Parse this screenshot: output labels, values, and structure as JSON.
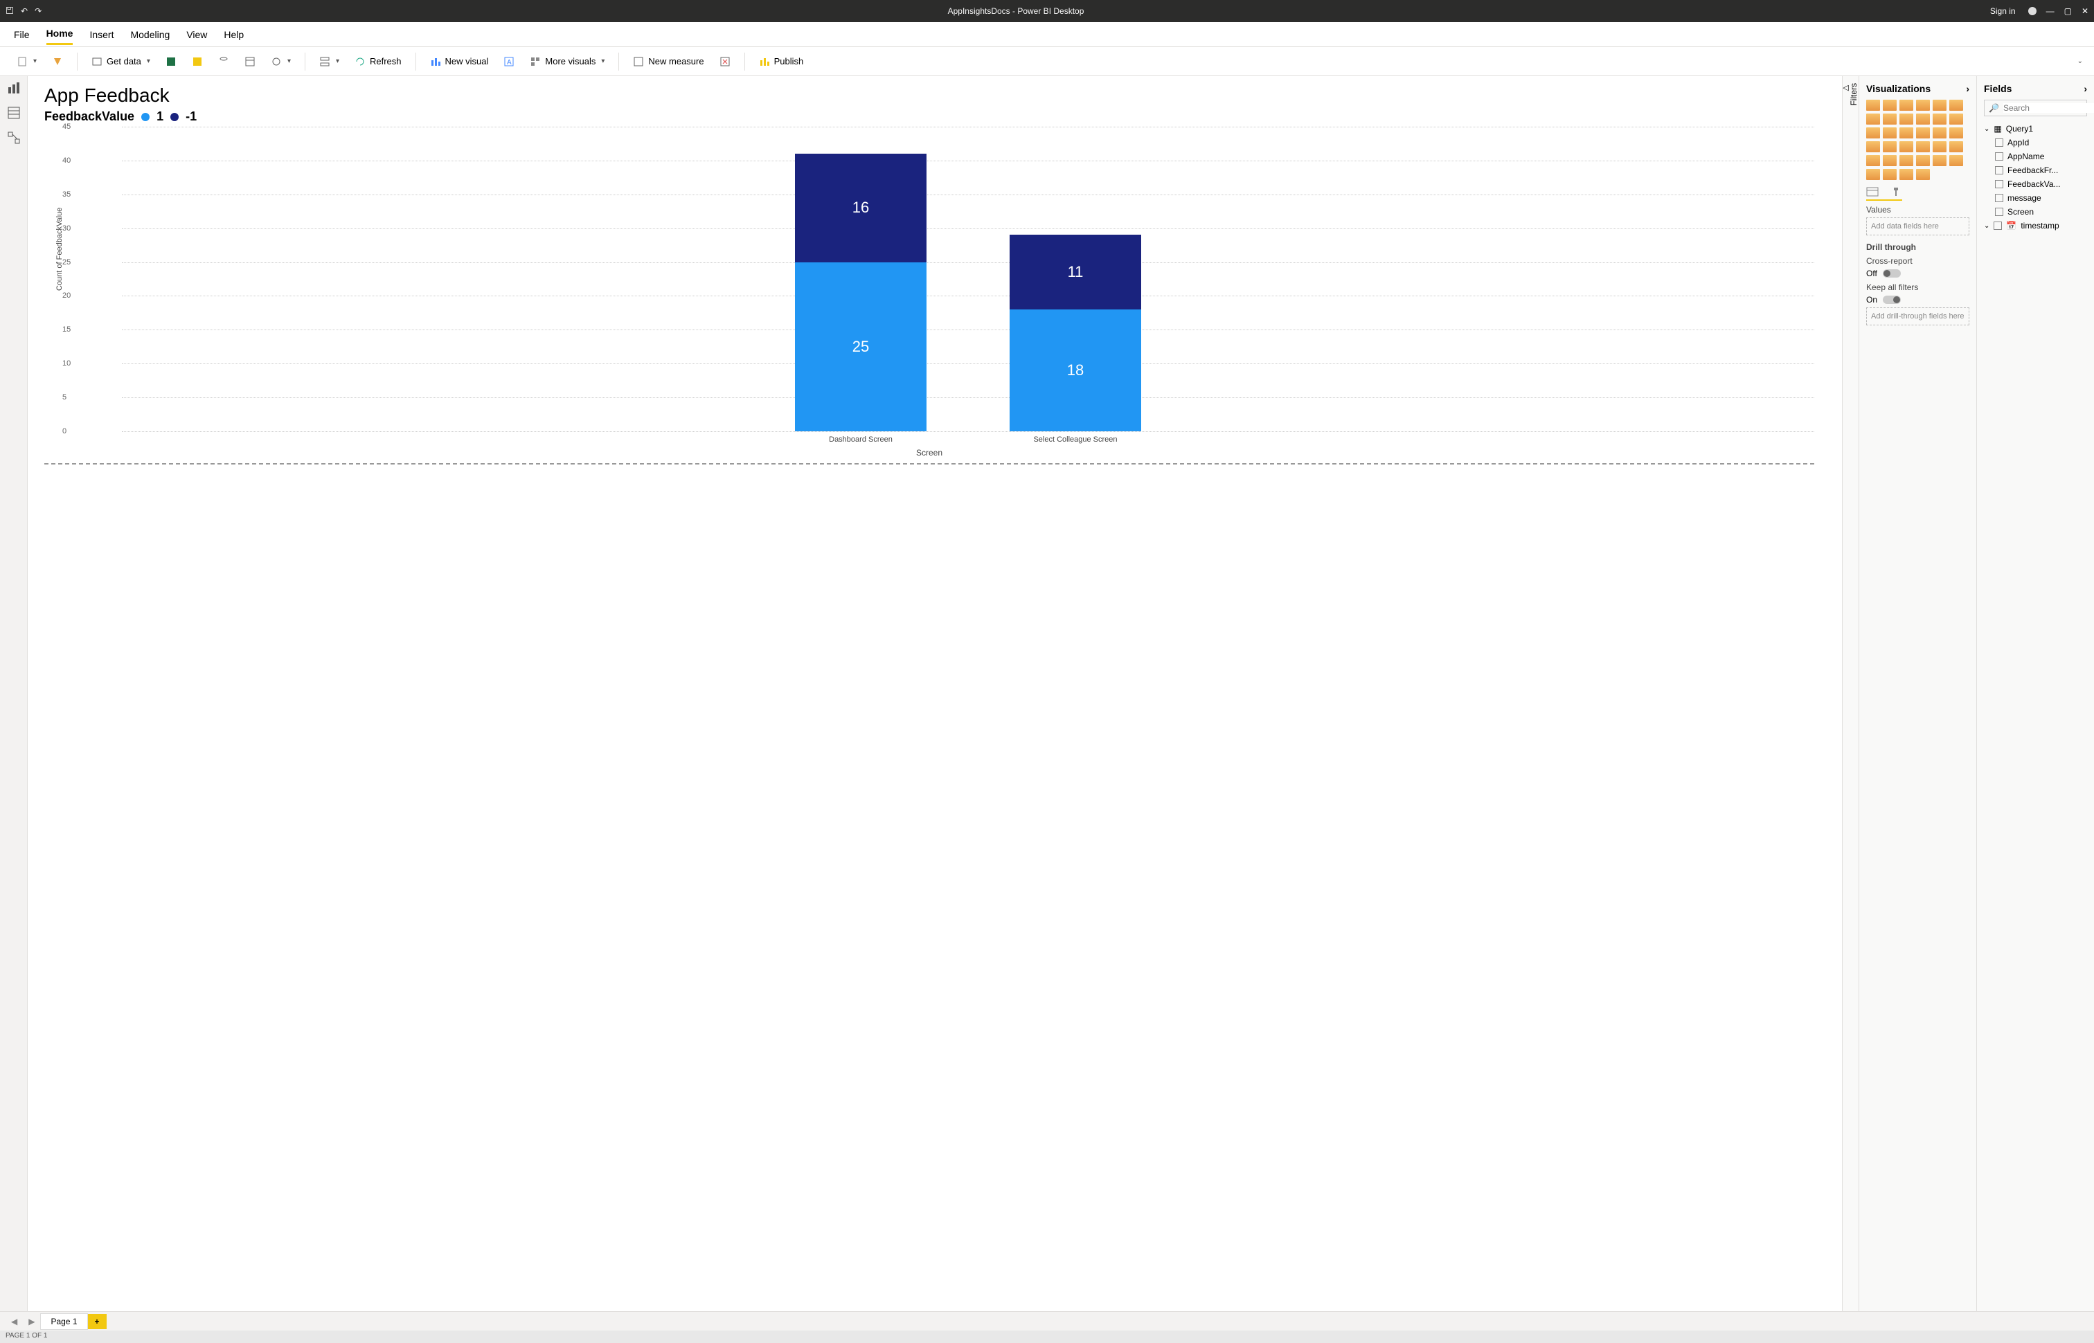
{
  "titlebar": {
    "doc_title": "AppInsightsDocs - Power BI Desktop",
    "signin": "Sign in"
  },
  "menus": [
    "File",
    "Home",
    "Insert",
    "Modeling",
    "View",
    "Help"
  ],
  "active_menu": "Home",
  "ribbon": {
    "getdata": "Get data",
    "refresh": "Refresh",
    "newvisual": "New visual",
    "morevisuals": "More visuals",
    "newmeasure": "New measure",
    "publish": "Publish"
  },
  "report": {
    "title": "App Feedback",
    "legend_title": "FeedbackValue",
    "legend": [
      {
        "label": "1",
        "color": "#2196f3"
      },
      {
        "label": "-1",
        "color": "#1a237e"
      }
    ]
  },
  "chart_data": {
    "type": "bar",
    "stacked": true,
    "title": "App Feedback",
    "xlabel": "Screen",
    "ylabel": "Count of FeedbackValue",
    "ylim": [
      0,
      45
    ],
    "yticks": [
      0,
      5,
      10,
      15,
      20,
      25,
      30,
      35,
      40,
      45
    ],
    "categories": [
      "Dashboard Screen",
      "Select Colleague Screen"
    ],
    "series": [
      {
        "name": "1",
        "color": "#2196f3",
        "values": [
          25,
          18
        ]
      },
      {
        "name": "-1",
        "color": "#1a237e",
        "values": [
          16,
          11
        ]
      }
    ]
  },
  "filters_tab": "Filters",
  "viz_panel": {
    "title": "Visualizations",
    "values_label": "Values",
    "values_placeholder": "Add data fields here",
    "drill_title": "Drill through",
    "cross_report": "Cross-report",
    "cross_state": "Off",
    "keep_filters": "Keep all filters",
    "keep_state": "On",
    "drill_placeholder": "Add drill-through fields here"
  },
  "fields_panel": {
    "title": "Fields",
    "search_placeholder": "Search",
    "table": "Query1",
    "columns": [
      "AppId",
      "AppName",
      "FeedbackFr...",
      "FeedbackVa...",
      "message",
      "Screen"
    ],
    "timestamp": "timestamp"
  },
  "tabbar": {
    "page": "Page 1"
  },
  "status": "PAGE 1 OF 1"
}
